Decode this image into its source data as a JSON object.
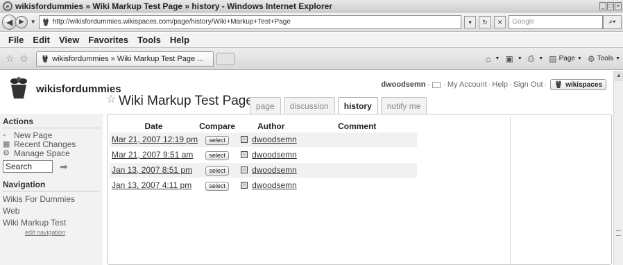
{
  "window": {
    "title": "wikisfordummies » Wiki Markup Test Page » history - Windows Internet Explorer",
    "buttons": [
      "minimize",
      "maximize",
      "close"
    ]
  },
  "address_bar": {
    "url": "http://wikisfordummies.wikispaces.com/page/history/Wiki+Markup+Test+Page",
    "search_placeholder": "Google"
  },
  "menu": [
    "File",
    "Edit",
    "View",
    "Favorites",
    "Tools",
    "Help"
  ],
  "browser_tab": {
    "label": "wikisfordummies » Wiki Markup Test Page ..."
  },
  "commands": {
    "page": "Page",
    "tools": "Tools"
  },
  "wiki": {
    "name": "wikisfordummies",
    "user": "dwoodsemn",
    "links": [
      "My Account",
      "Help",
      "Sign Out"
    ],
    "wikispaces_btn": "wikispaces"
  },
  "page": {
    "title": "Wiki Markup Test Page",
    "tabs": [
      "page",
      "discussion",
      "history",
      "notify me"
    ],
    "active_tab": "history"
  },
  "sidebar": {
    "actions_heading": "Actions",
    "actions": [
      "New Page",
      "Recent Changes",
      "Manage Space"
    ],
    "search_value": "Search",
    "navigation_heading": "Navigation",
    "nav_links": [
      "Wikis For Dummies",
      "Web",
      "Wiki Markup Test"
    ],
    "edit_nav": "edit navigation"
  },
  "history": {
    "columns": [
      "Date",
      "Compare",
      "Author",
      "Comment"
    ],
    "select_label": "select",
    "rows": [
      {
        "date": "Mar 21, 2007 12:19 pm",
        "author": "dwoodsemn"
      },
      {
        "date": "Mar 21, 2007 9:51 am",
        "author": "dwoodsemn"
      },
      {
        "date": "Jan 13, 2007 8:51 pm",
        "author": "dwoodsemn"
      },
      {
        "date": "Jan 13, 2007 4:11 pm",
        "author": "dwoodsemn"
      }
    ]
  }
}
